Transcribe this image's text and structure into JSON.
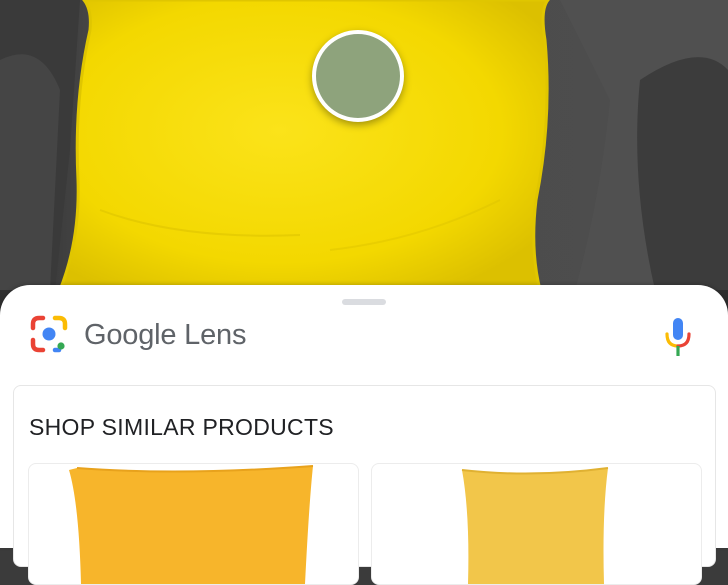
{
  "header": {
    "brand_label": "Google Lens"
  },
  "results": {
    "section_title": "SHOP SIMILAR PRODUCTS"
  },
  "icons": {
    "lens": "google-lens-icon",
    "mic": "microphone-icon"
  },
  "colors": {
    "pillow_yellow": "#f5dc00",
    "focus_dot": "#8ea37c",
    "sofa_gray": "#4a4a4a",
    "product_orange": "#f7b52b",
    "product_yellow": "#f2c64a",
    "google_blue": "#4285f4",
    "google_red": "#ea4335",
    "google_yellow": "#fbbc05",
    "google_green": "#34a853"
  }
}
